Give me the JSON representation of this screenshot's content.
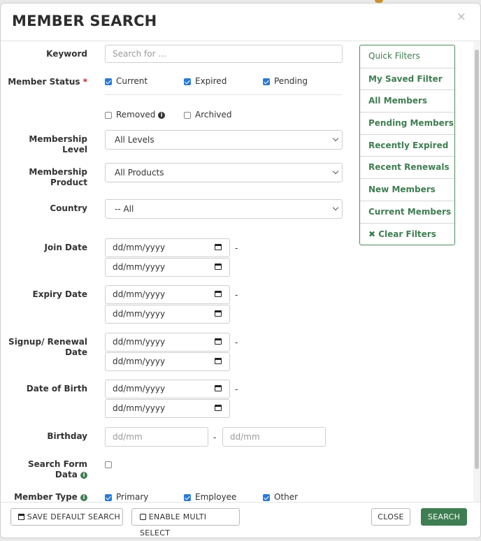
{
  "title": "MEMBER SEARCH",
  "close_icon": "×",
  "keyword": {
    "label": "Keyword",
    "placeholder": "Search for ..."
  },
  "member_status": {
    "label": "Member Status",
    "required": "*",
    "options": [
      {
        "label": "Current",
        "checked": true
      },
      {
        "label": "Expired",
        "checked": true
      },
      {
        "label": "Pending",
        "checked": true
      },
      {
        "label": "Removed",
        "checked": false
      },
      {
        "label": "Archived",
        "checked": false
      }
    ]
  },
  "membership_level": {
    "label_1": "Membership",
    "label_2": "Level",
    "value": "All Levels"
  },
  "membership_product": {
    "label_1": "Membership",
    "label_2": "Product",
    "value": "All Products"
  },
  "country": {
    "label": "Country",
    "value": "-- All"
  },
  "date_placeholder": "dd/mm/yyyy",
  "range_dash": "-",
  "join_date": {
    "label": "Join Date"
  },
  "expiry_date": {
    "label": "Expiry Date"
  },
  "signup_renewal": {
    "label_1": "Signup/ Renewal",
    "label_2": "Date"
  },
  "date_of_birth": {
    "label": "Date of Birth"
  },
  "birthday": {
    "label": "Birthday",
    "placeholder": "dd/mm"
  },
  "search_form_data": {
    "label_1": "Search Form",
    "label_2": "Data",
    "checked": false
  },
  "member_type": {
    "label": "Member Type",
    "options": [
      {
        "label": "Primary",
        "checked": true
      },
      {
        "label": "Employee",
        "checked": true
      },
      {
        "label": "Other",
        "checked": true
      }
    ]
  },
  "quick_filters": {
    "heading": "Quick Filters",
    "items": [
      "My Saved Filter",
      "All Members",
      "Pending Members",
      "Recently Expired",
      "Recent Renewals",
      "New Members",
      "Current Members"
    ],
    "clear": "Clear Filters",
    "clear_icon": "✖"
  },
  "footer": {
    "save_default": "SAVE DEFAULT SEARCH",
    "enable_multi": "ENABLE MULTI SELECT",
    "close": "CLOSE",
    "search": "SEARCH"
  },
  "colors": {
    "accent": "#3f7d52",
    "checkbox": "#2a7ad6",
    "required": "#cc2222"
  },
  "icons": [
    "close-icon",
    "info-icon",
    "calendar-icon",
    "chevron-down-icon",
    "clear-icon",
    "save-icon",
    "checkbox-icon"
  ]
}
